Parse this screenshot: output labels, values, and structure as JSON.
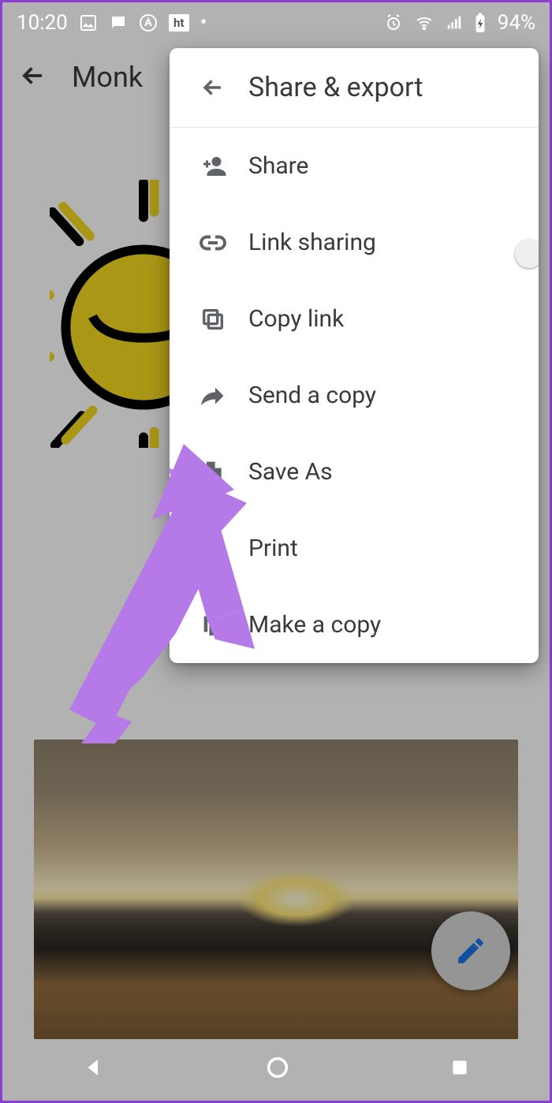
{
  "status": {
    "time": "10:20",
    "battery": "94%"
  },
  "appbar": {
    "title": "Monk"
  },
  "menu": {
    "title": "Share & export",
    "items": [
      {
        "label": "Share"
      },
      {
        "label": "Link sharing",
        "toggle": false
      },
      {
        "label": "Copy link"
      },
      {
        "label": "Send a copy"
      },
      {
        "label": "Save As"
      },
      {
        "label": "Print"
      },
      {
        "label": "Make a copy"
      }
    ]
  }
}
